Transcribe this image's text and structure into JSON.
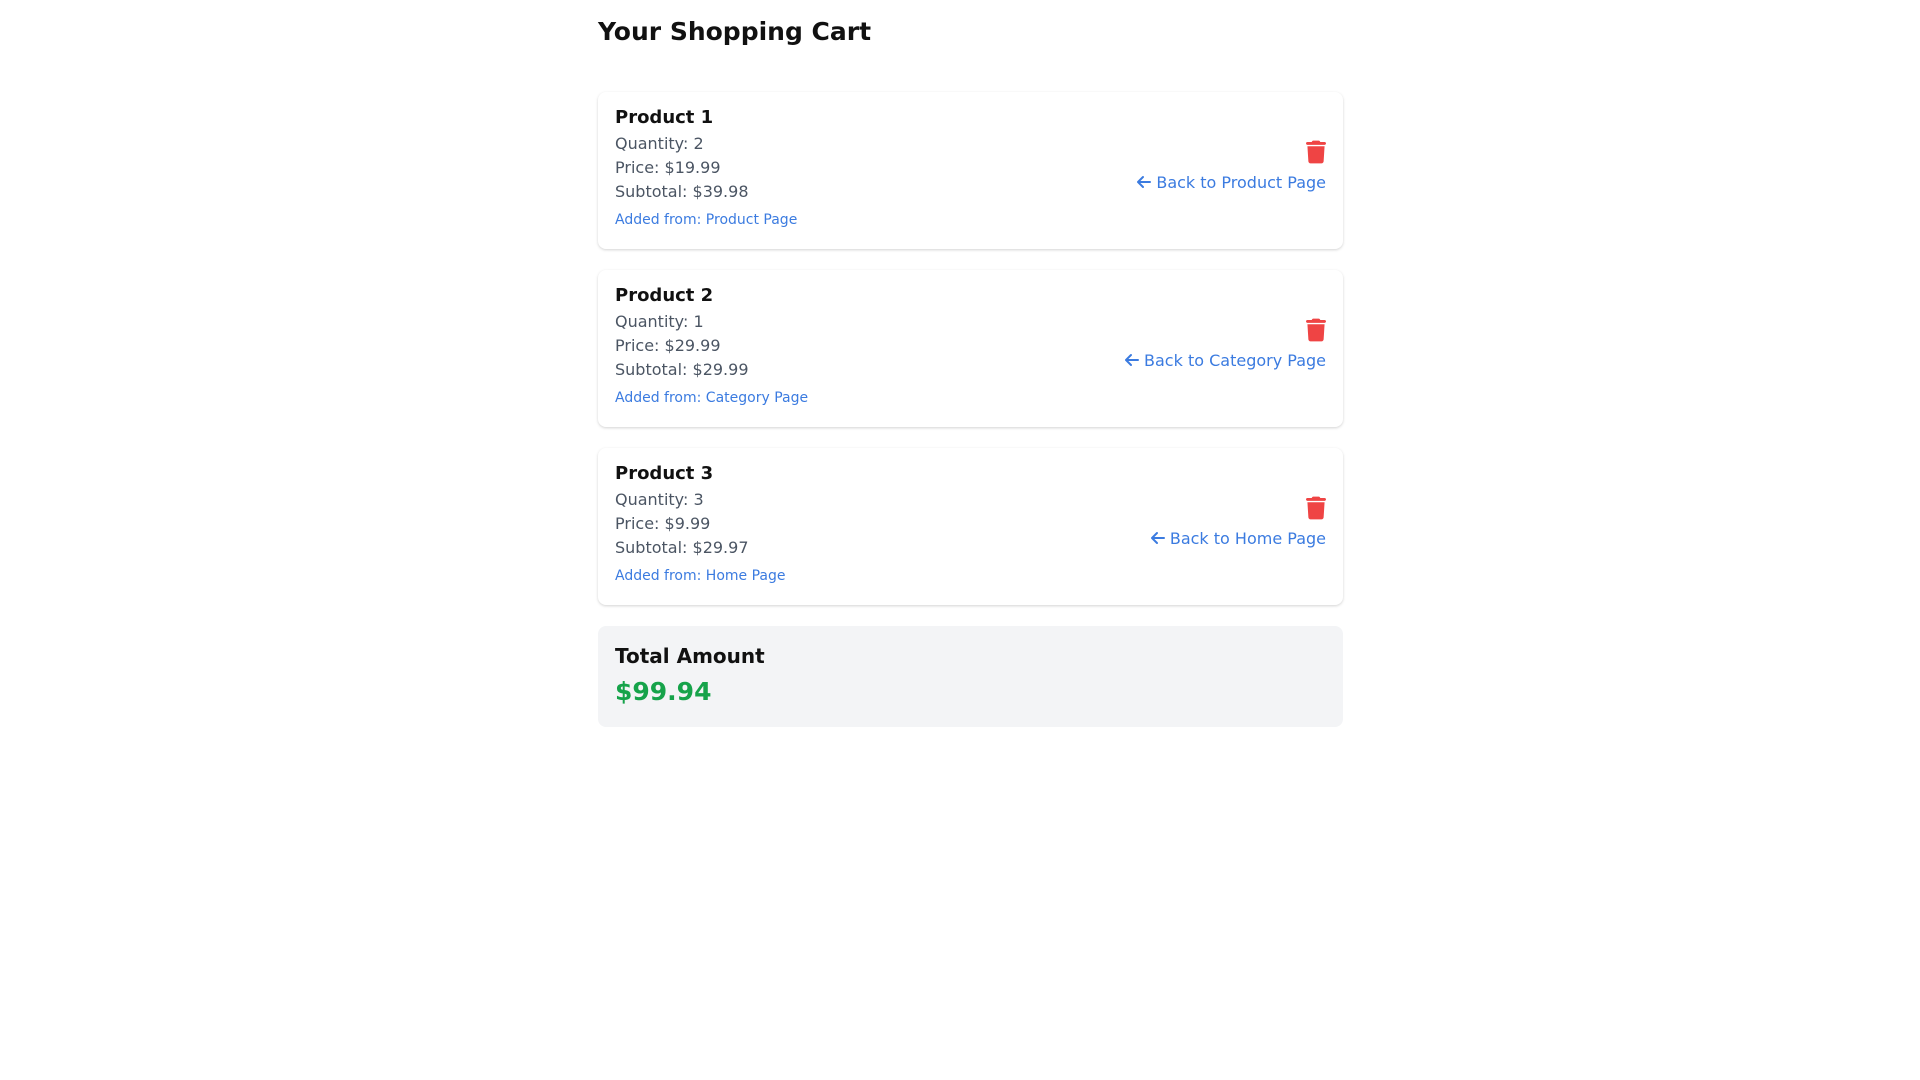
{
  "page": {
    "title": "Your Shopping Cart"
  },
  "colors": {
    "link": "#3b7be0",
    "delete": "#ef4444",
    "total": "#16a34a",
    "total_background": "#f3f4f6"
  },
  "icons": {
    "delete": "trash-icon",
    "back": "arrow-left-icon"
  },
  "cart": {
    "items": [
      {
        "name": "Product 1",
        "quantity": "Quantity: 2",
        "price": "Price: $19.99",
        "subtotal": "Subtotal: $39.98",
        "origin": "Added from: Product Page",
        "back_label": "Back to Product Page"
      },
      {
        "name": "Product 2",
        "quantity": "Quantity: 1",
        "price": "Price: $29.99",
        "subtotal": "Subtotal: $29.99",
        "origin": "Added from: Category Page",
        "back_label": "Back to Category Page"
      },
      {
        "name": "Product 3",
        "quantity": "Quantity: 3",
        "price": "Price: $9.99",
        "subtotal": "Subtotal: $29.97",
        "origin": "Added from: Home Page",
        "back_label": "Back to Home Page"
      }
    ]
  },
  "summary": {
    "label": "Total Amount",
    "amount": "$99.94"
  }
}
